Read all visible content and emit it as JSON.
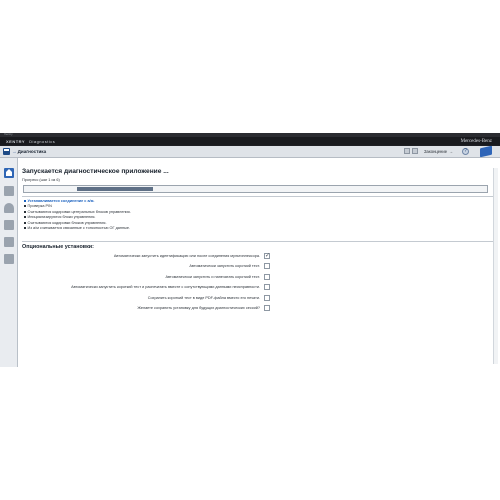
{
  "window": {
    "title": "Xentry"
  },
  "brand": {
    "product_bold": "XENTRY",
    "product_name": "Diagnostics",
    "company": "Mercedes-Benz"
  },
  "toolbar": {
    "breadcrumb": "Диагностика",
    "login_label": "Законцение",
    "login_arrow": "→",
    "help_glyph": "?"
  },
  "page": {
    "title": "Запускается диагностическое приложение ...",
    "progress_text": "Прогресс (шаг 1 из 6)",
    "progress_value": 0.16
  },
  "steps": [
    {
      "label": "Устанавливается соединение с а/м.",
      "current": true
    },
    {
      "label": "Проверка PIN",
      "current": false
    },
    {
      "label": "Считываются кодировки центральных блоков управления.",
      "current": false
    },
    {
      "label": "Инициализируются блоки управления.",
      "current": false
    },
    {
      "label": "Считываются кодировки блоков управления.",
      "current": false
    },
    {
      "label": "Из а/м считывается связанные с тонсиностью ОГ данные.",
      "current": false
    }
  ],
  "options": {
    "title": "Опциональные установки:",
    "items": [
      {
        "label": "Автоматически запустить идентификацию или после соединения мультиплексора.",
        "checked": true
      },
      {
        "label": "Автоматически запустить короткий тест.",
        "checked": false
      },
      {
        "label": "Автоматически запустить и напечатать короткий тест.",
        "checked": false
      },
      {
        "label": "Автоматически запустить короткий тест и распечатать вместе с сопутствующими данными неисправности.",
        "checked": false
      },
      {
        "label": "Сохранить короткий тест в виде PDF-файла вместо его печати.",
        "checked": false
      },
      {
        "label": "Желаете сохранить установку для будущих диагностических сессий?",
        "checked": false
      }
    ]
  },
  "colors": {
    "accent": "#2f66b5",
    "current_step": "#1c63c0",
    "brand_bar": "#191a1e"
  }
}
